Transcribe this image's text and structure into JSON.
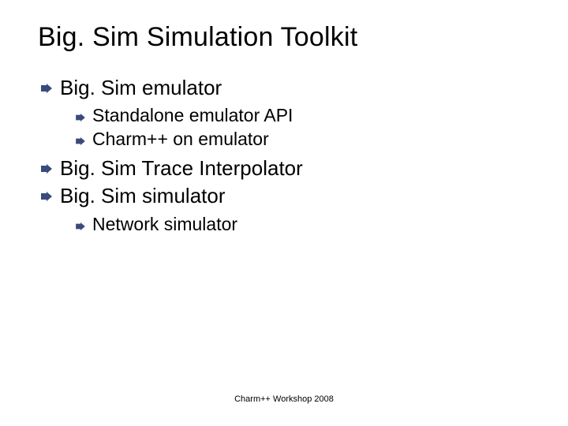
{
  "title": "Big. Sim Simulation Toolkit",
  "items": [
    {
      "label": "Big. Sim emulator",
      "children": [
        {
          "label": "Standalone emulator API"
        },
        {
          "label": "Charm++ on emulator"
        }
      ]
    },
    {
      "label": "Big. Sim Trace Interpolator"
    },
    {
      "label": "Big. Sim simulator",
      "children": [
        {
          "label": "Network simulator"
        }
      ]
    }
  ],
  "footer": "Charm++ Workshop 2008",
  "style": {
    "arrow_fill": "#3a4a7a",
    "arrow_tip": "#1a2a5a"
  }
}
